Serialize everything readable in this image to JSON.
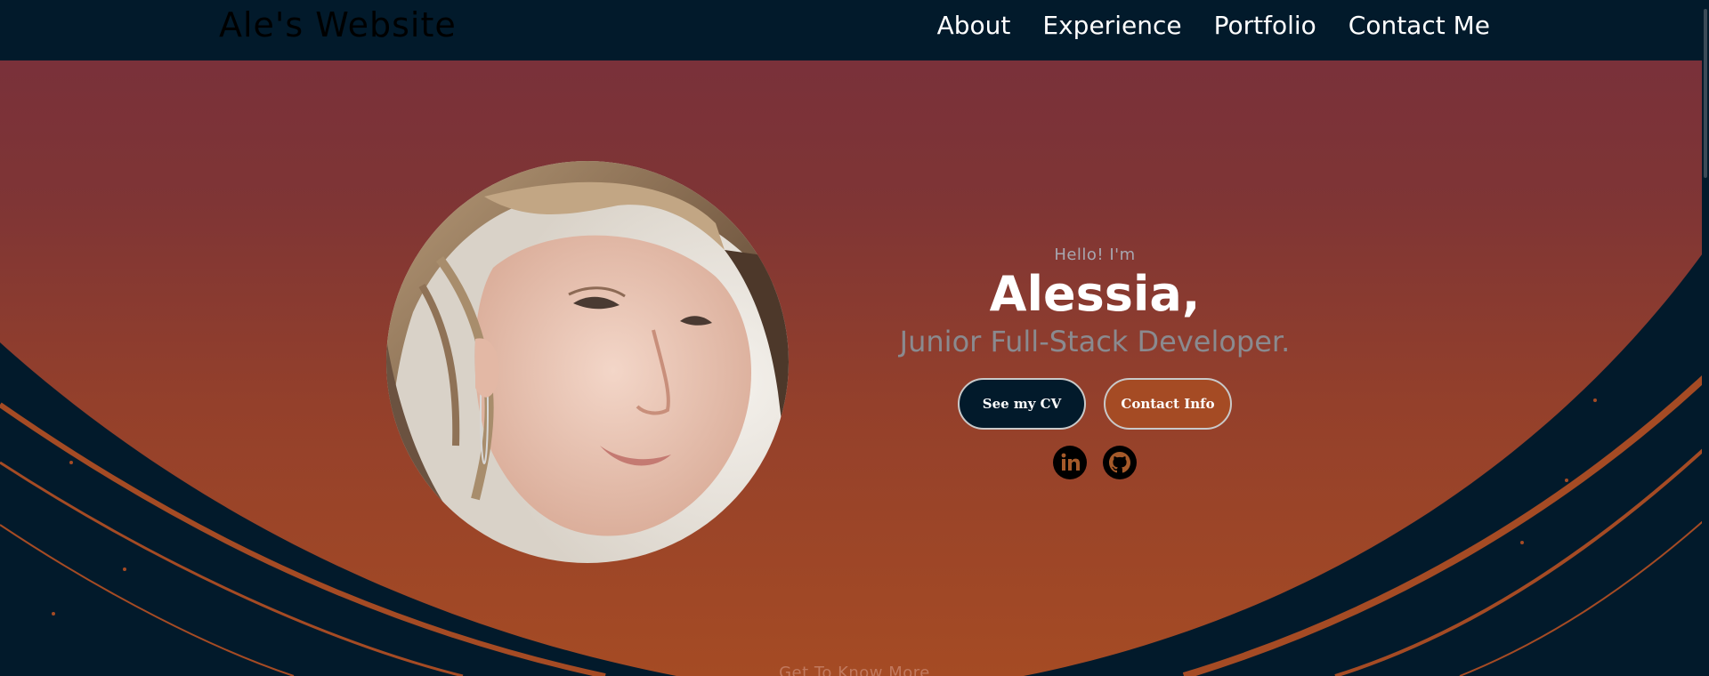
{
  "header": {
    "brand": "Ale's Website",
    "nav": [
      {
        "label": "About"
      },
      {
        "label": "Experience"
      },
      {
        "label": "Portfolio"
      },
      {
        "label": "Contact Me"
      }
    ]
  },
  "intro": {
    "greeting": "Hello! I'm",
    "name": "Alessia,",
    "role": "Junior Full-Stack Developer.",
    "buttons": {
      "cv": "See my CV",
      "contact": "Contact Info"
    },
    "socials": [
      {
        "icon": "linkedin-icon"
      },
      {
        "icon": "github-icon"
      }
    ]
  },
  "footer_hint": "Get To Know More",
  "colors": {
    "navy": "#021a2b",
    "accent": "#a54b24",
    "gradient_top": "#772f3c"
  }
}
